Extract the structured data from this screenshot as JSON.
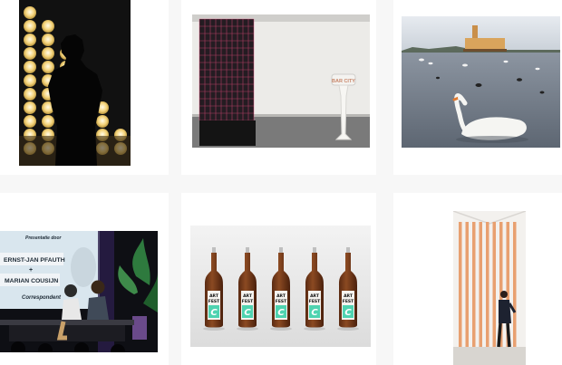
{
  "grid": {
    "columns": 3,
    "rows": 2,
    "background": "#f7f7f7",
    "card_color": "#ffffff"
  },
  "posts": [
    {
      "id": "p1",
      "subject": "silhouette-light-wall",
      "text": []
    },
    {
      "id": "p2",
      "subject": "gallery-installation",
      "text": [
        "BAR CITY"
      ]
    },
    {
      "id": "p3",
      "subject": "swan-lake",
      "text": []
    },
    {
      "id": "p4",
      "subject": "stage-presentation",
      "slide": {
        "line1": "Presentatie door",
        "line2": "ERNST-JAN PFAUTH",
        "line3": "+",
        "line4": "MARIAN COUSIJN",
        "logo": "Correspondent"
      }
    },
    {
      "id": "p5",
      "subject": "beer-bottles",
      "bottle_count": 5,
      "label": {
        "line1": "ART",
        "line2": "FEST",
        "mark": "C"
      }
    },
    {
      "id": "p6",
      "subject": "striped-room",
      "text": []
    }
  ],
  "colors": {
    "warm_light": "#f4d37a",
    "water": "#6d7784",
    "slide_bg": "#d9e6ee",
    "bottle": "#7b3b1c",
    "label_mint": "#4fd3b0",
    "stripe": "#e8a070"
  }
}
